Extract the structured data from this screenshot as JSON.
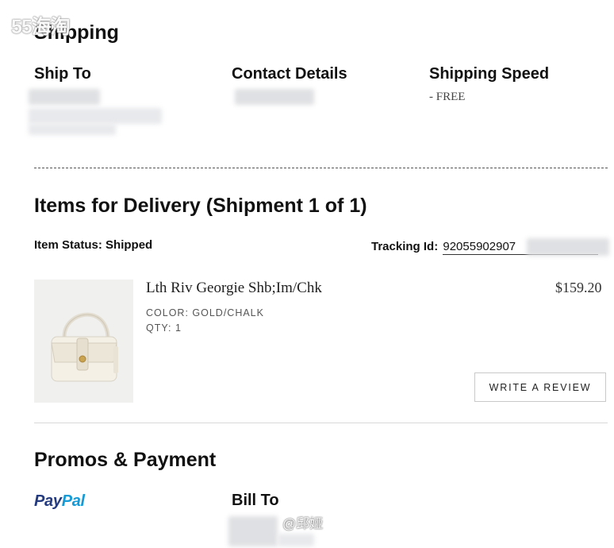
{
  "watermark": {
    "site": "55海淘",
    "credit": "@邱娅"
  },
  "shipping": {
    "title": "Shipping",
    "ship_to_label": "Ship To",
    "contact_label": "Contact Details",
    "speed_label": "Shipping Speed",
    "speed_value": "- FREE"
  },
  "delivery": {
    "title": "Items for Delivery (Shipment 1 of 1)",
    "status_label": "Item Status:",
    "status_value": "Shipped",
    "tracking_label": "Tracking Id:",
    "tracking_value": "92055902907"
  },
  "item": {
    "name": "Lth Riv Georgie Shb;Im/Chk",
    "price": "$159.20",
    "color": "COLOR: GOLD/CHALK",
    "qty": "QTY: 1",
    "review_button": "WRITE A REVIEW",
    "image_icon": "handbag-icon"
  },
  "payment": {
    "title": "Promos & Payment",
    "paypal_a": "Pay",
    "paypal_b": "Pal",
    "paypal_colors": {
      "pay": "#253b80",
      "pal": "#179bd7"
    },
    "bill_to_label": "Bill To"
  }
}
